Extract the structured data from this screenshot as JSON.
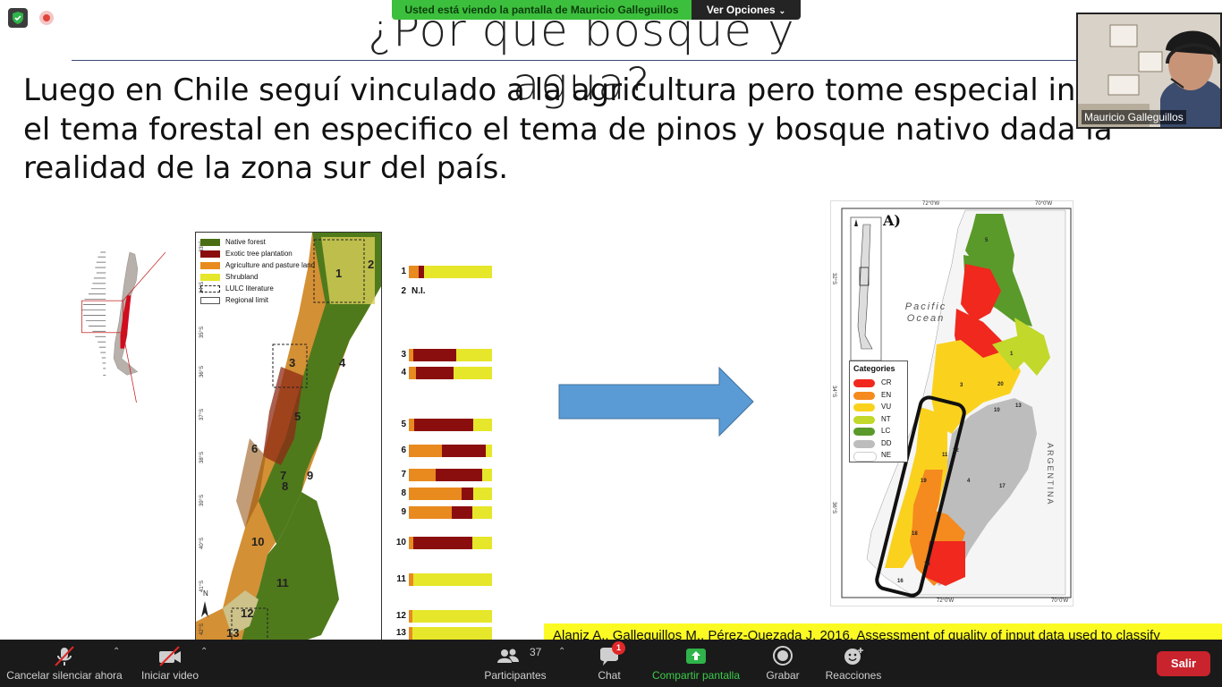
{
  "meeting": {
    "share_banner": "Usted está viendo la pantalla de Mauricio Galleguillos",
    "view_options": "Ver Opciones",
    "participant_name": "Mauricio Galleguillos"
  },
  "slide": {
    "title": "¿Por que bosque y agua?",
    "body": "Luego en Chile seguí vinculado a la agricultura pero tome especial interés en el tema forestal en especifico el tema de pinos y bosque nativo dada la realidad de la zona sur del país.",
    "citation": "Alaniz A., Galleguillos M., Pérez-Quezada J. 2016. Assessment of quality of input data used to classify",
    "left_figure": {
      "legend": [
        {
          "label": "Native forest",
          "color": "#4a6e14"
        },
        {
          "label": "Exotic tree plantation",
          "color": "#8b0e0e"
        },
        {
          "label": "Agriculture and pasture land",
          "color": "#e88a1e"
        },
        {
          "label": "Shrubland",
          "color": "#e6e62a"
        },
        {
          "label": "LULC literature",
          "color": "dashed"
        },
        {
          "label": "Regional limit",
          "color": "outline"
        }
      ],
      "lat_labels": [
        "33°S",
        "34°S",
        "35°S",
        "36°S",
        "37°S",
        "38°S",
        "39°S",
        "40°S",
        "41°S",
        "42°S"
      ],
      "region_numbers": [
        "1",
        "2",
        "3",
        "4",
        "5",
        "6",
        "7",
        "8",
        "9",
        "10",
        "11",
        "12",
        "13"
      ],
      "bar_rows": [
        {
          "id": "1",
          "segments": [
            [
              "#e88a1e",
              12
            ],
            [
              "#8b0e0e",
              6
            ],
            [
              "#e6e62a",
              82
            ]
          ]
        },
        {
          "id": "2",
          "na_label": "N.I."
        },
        {
          "id": "3",
          "segments": [
            [
              "#e88a1e",
              5
            ],
            [
              "#8b0e0e",
              52
            ],
            [
              "#e6e62a",
              43
            ]
          ]
        },
        {
          "id": "4",
          "segments": [
            [
              "#e88a1e",
              9
            ],
            [
              "#8b0e0e",
              45
            ],
            [
              "#e6e62a",
              46
            ]
          ]
        },
        {
          "id": "5",
          "segments": [
            [
              "#e88a1e",
              6
            ],
            [
              "#8b0e0e",
              71
            ],
            [
              "#e6e62a",
              23
            ]
          ]
        },
        {
          "id": "6",
          "segments": [
            [
              "#e88a1e",
              40
            ],
            [
              "#8b0e0e",
              52
            ],
            [
              "#e6e62a",
              8
            ]
          ]
        },
        {
          "id": "7",
          "segments": [
            [
              "#e88a1e",
              32
            ],
            [
              "#8b0e0e",
              56
            ],
            [
              "#e6e62a",
              12
            ]
          ]
        },
        {
          "id": "8",
          "segments": [
            [
              "#e88a1e",
              63
            ],
            [
              "#8b0e0e",
              14
            ],
            [
              "#e6e62a",
              23
            ]
          ]
        },
        {
          "id": "9",
          "segments": [
            [
              "#e88a1e",
              52
            ],
            [
              "#8b0e0e",
              24
            ],
            [
              "#e6e62a",
              24
            ]
          ]
        },
        {
          "id": "10",
          "segments": [
            [
              "#e88a1e",
              5
            ],
            [
              "#8b0e0e",
              71
            ],
            [
              "#e6e62a",
              24
            ]
          ]
        },
        {
          "id": "11",
          "segments": [
            [
              "#e88a1e",
              5
            ],
            [
              "#e6e62a",
              95
            ]
          ]
        },
        {
          "id": "12",
          "segments": [
            [
              "#e88a1e",
              4
            ],
            [
              "#e6e62a",
              96
            ]
          ]
        },
        {
          "id": "13",
          "segments": [
            [
              "#e88a1e",
              4
            ],
            [
              "#e6e62a",
              96
            ]
          ]
        }
      ]
    },
    "right_figure": {
      "panel_label": "A)",
      "ocean_label": "Pacific Ocean",
      "country_label": "ARGENTINA",
      "legend_title": "Categories",
      "coords": [
        "72°0'W",
        "70°0'W",
        "32°S",
        "34°S",
        "36°S"
      ],
      "categories": [
        {
          "label": "CR",
          "color": "#f0281e"
        },
        {
          "label": "EN",
          "color": "#f58a1e"
        },
        {
          "label": "VU",
          "color": "#fad21e"
        },
        {
          "label": "NT",
          "color": "#c2d82a"
        },
        {
          "label": "LC",
          "color": "#5a9a2a"
        },
        {
          "label": "DD",
          "color": "#bdbdbd"
        },
        {
          "label": "NE",
          "color": "#ffffff"
        }
      ]
    }
  },
  "toolbar": {
    "mute": "Cancelar silenciar ahora",
    "video": "Iniciar video",
    "participants": "Participantes",
    "participants_count": "37",
    "chat": "Chat",
    "chat_badge": "1",
    "share": "Compartir pantalla",
    "record": "Grabar",
    "reactions": "Reacciones",
    "leave": "Salir"
  }
}
